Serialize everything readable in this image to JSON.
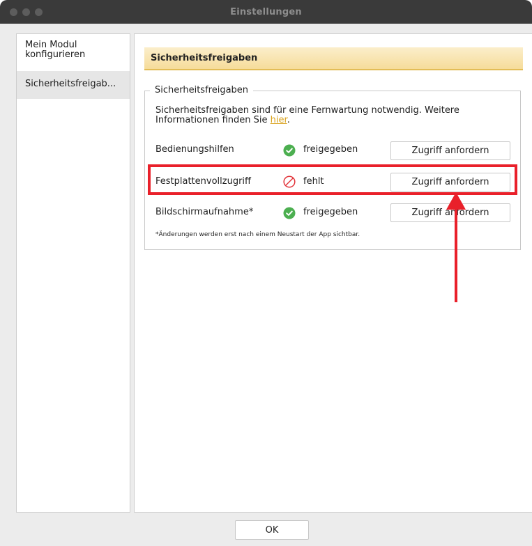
{
  "window": {
    "title": "Einstellungen"
  },
  "sidebar": {
    "items": [
      {
        "label": "Mein Modul konfigurieren",
        "line1": "Mein Modul",
        "line2": "konfigurieren"
      },
      {
        "label": "Sicherheitsfreigab..."
      }
    ]
  },
  "main": {
    "header": "Sicherheitsfreigaben",
    "group": {
      "legend": "Sicherheitsfreigaben",
      "intro_line1": "Sicherheitsfreigaben sind für eine Fernwartung notwendig. Weitere",
      "intro_line2_prefix": "Informationen finden Sie ",
      "intro_link": "hier",
      "intro_line2_suffix": ".",
      "permissions": [
        {
          "label": "Bedienungshilfen",
          "status": "freigegeben",
          "status_icon": "check-circle-icon",
          "button": "Zugriff anfordern"
        },
        {
          "label": "Festplattenvollzugriff",
          "status": "fehlt",
          "status_icon": "prohibited-icon",
          "button": "Zugriff anfordern"
        },
        {
          "label": "Bildschirmaufnahme*",
          "status": "freigegeben",
          "status_icon": "check-circle-icon",
          "button": "Zugriff anfordern"
        }
      ],
      "footnote": "*Änderungen werden erst nach einem Neustart der App sichtbar."
    }
  },
  "footer": {
    "ok_label": "OK"
  },
  "colors": {
    "titlebar": "#3a3a3a",
    "header_gradient_top": "#fbeecb",
    "header_gradient_bottom": "#f6dc9a",
    "link": "#d9a21c",
    "status_ok": "#4caf50",
    "status_missing": "#e2343a",
    "annotation": "#e9202a"
  }
}
